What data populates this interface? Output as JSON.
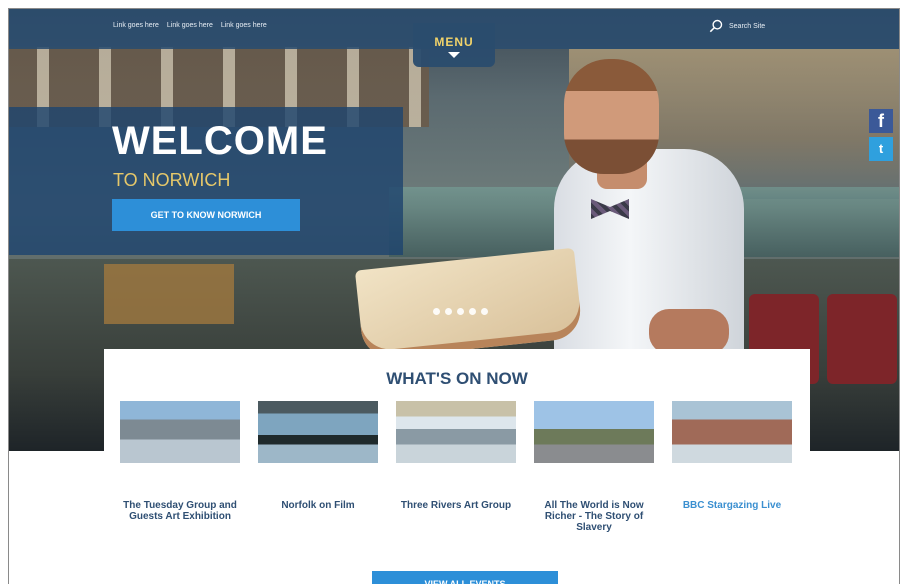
{
  "header": {
    "links": [
      "Link goes here",
      "Link goes here",
      "Link goes here"
    ],
    "menu_label": "MENU",
    "search_label": "Search Site"
  },
  "hero": {
    "title": "WELCOME",
    "subtitle": "TO NORWICH",
    "cta_label": "GET TO KNOW NORWICH",
    "slide_count": 5
  },
  "social": {
    "facebook_glyph": "f",
    "twitter_glyph": "t"
  },
  "whats_on": {
    "title": "WHAT'S ON NOW",
    "events": [
      {
        "title": "The Tuesday Group and Guests Art Exhibition"
      },
      {
        "title": "Norfolk on Film"
      },
      {
        "title": "Three Rivers Art Group"
      },
      {
        "title": "All The World is Now Richer - The Story of Slavery"
      },
      {
        "title": "BBC Stargazing Live"
      }
    ],
    "view_all_label": "VIEW ALL EVENTS"
  },
  "colors": {
    "brand_navy": "#2a4c6e",
    "accent_blue": "#2d8fd8",
    "accent_gold": "#e6c86a",
    "heading_navy": "#2f4f73"
  }
}
